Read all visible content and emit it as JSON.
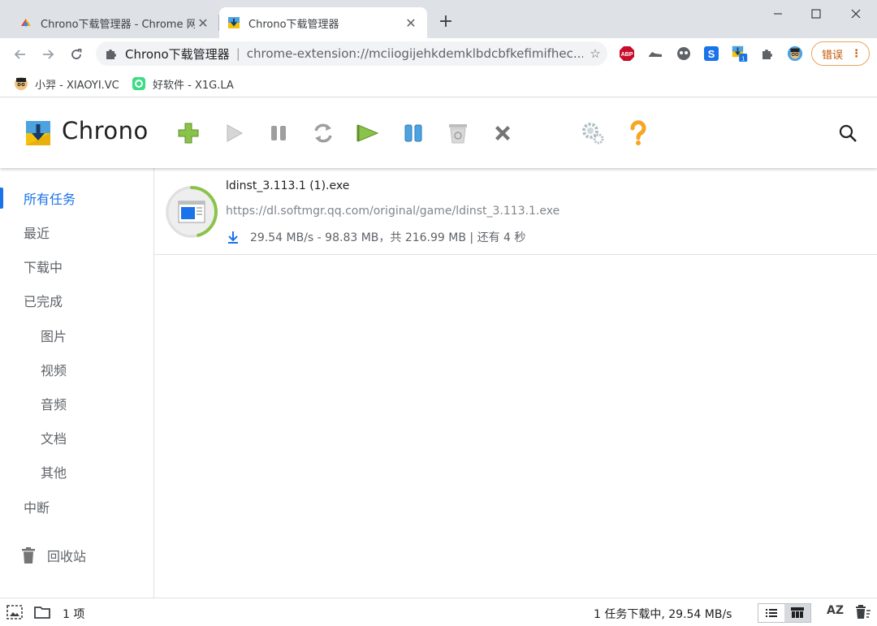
{
  "browser": {
    "tabs": [
      {
        "title": "Chrono下载管理器 - Chrome 网",
        "active": false
      },
      {
        "title": "Chrono下载管理器",
        "active": true
      }
    ],
    "address": {
      "host": "Chrono下载管理器",
      "url": "chrome-extension://mciiogijehkdemklbdcbfkefimifhec..."
    },
    "error_button": "错误",
    "bookmarks": [
      {
        "label": "小羿 - XIAOYI.VC"
      },
      {
        "label": "好软件 - X1G.LA"
      }
    ],
    "extension_badge": "1",
    "abp_label": "ABP"
  },
  "app": {
    "title": "Chrono",
    "sidebar": {
      "items": [
        {
          "label": "所有任务",
          "active": true,
          "sub": false
        },
        {
          "label": "最近",
          "active": false,
          "sub": false
        },
        {
          "label": "下载中",
          "active": false,
          "sub": false
        },
        {
          "label": "已完成",
          "active": false,
          "sub": false
        },
        {
          "label": "图片",
          "active": false,
          "sub": true
        },
        {
          "label": "视频",
          "active": false,
          "sub": true
        },
        {
          "label": "音频",
          "active": false,
          "sub": true
        },
        {
          "label": "文档",
          "active": false,
          "sub": true
        },
        {
          "label": "其他",
          "active": false,
          "sub": true
        },
        {
          "label": "中断",
          "active": false,
          "sub": false
        }
      ],
      "trash": "回收站"
    },
    "downloads": [
      {
        "filename": "ldinst_3.113.1 (1).exe",
        "url": "https://dl.softmgr.qq.com/original/game/ldinst_3.113.1.exe",
        "status": "29.54 MB/s - 98.83 MB，共 216.99 MB | 还有 4 秒",
        "progress": 0.455
      }
    ],
    "statusbar": {
      "count": "1 项",
      "summary": "1 任务下载中, 29.54 MB/s",
      "sort_label": "AZ"
    }
  },
  "colors": {
    "accent": "#1a73e8",
    "progress": "#8bc34a",
    "add_green": "#7cb342",
    "help_orange": "#f5a623"
  }
}
